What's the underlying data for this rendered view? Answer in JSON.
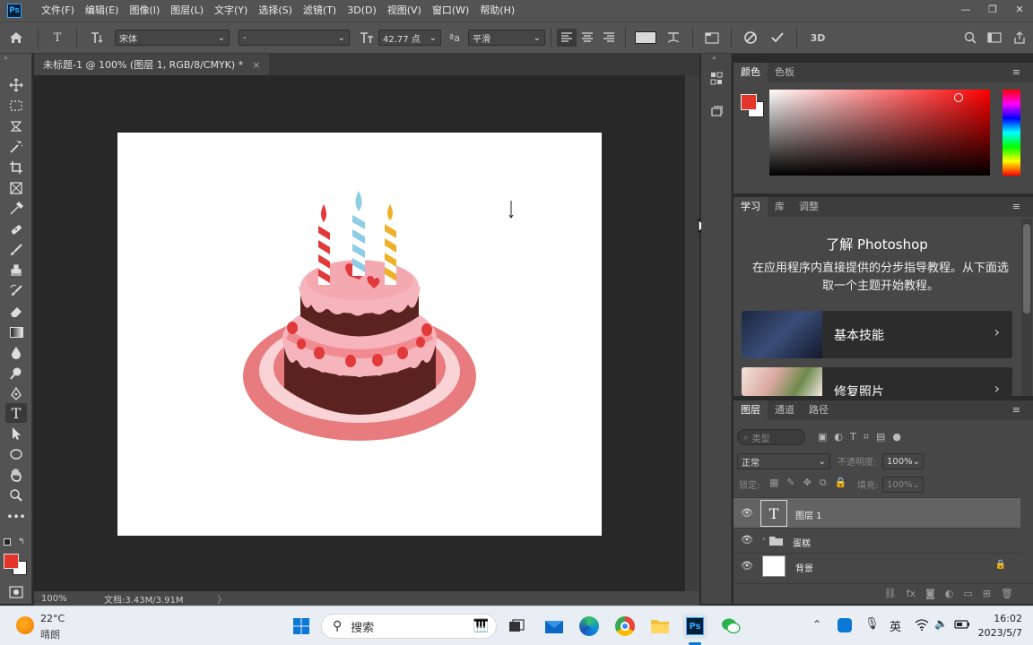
{
  "app": {
    "logo": "Ps"
  },
  "menu": [
    "文件(F)",
    "编辑(E)",
    "图像(I)",
    "图层(L)",
    "文字(Y)",
    "选择(S)",
    "滤镜(T)",
    "3D(D)",
    "视图(V)",
    "窗口(W)",
    "帮助(H)"
  ],
  "window_controls": {
    "minimize": "—",
    "restore": "❐",
    "close": "✕"
  },
  "options_bar": {
    "font_family": "宋体",
    "font_style": "-",
    "font_size": "42.77 点",
    "aa_label": "ªa",
    "antialias": "平滑",
    "mode_3d": "3D"
  },
  "document": {
    "tab_title": "未标题-1 @ 100% (图层 1, RGB/8/CMYK) *",
    "tab_close": "×"
  },
  "status": {
    "zoom": "100%",
    "doc_size": "文档:3.43M/3.91M",
    "arrow": "〉"
  },
  "color_panel": {
    "tabs": [
      "颜色",
      "色板"
    ],
    "foreground": "#e1352a",
    "background": "#ffffff"
  },
  "learn_panel": {
    "tabs": [
      "学习",
      "库",
      "调整"
    ],
    "title": "了解 Photoshop",
    "description": "在应用程序内直接提供的分步指导教程。从下面选取一个主题开始教程。",
    "cards": [
      {
        "label": "基本技能"
      },
      {
        "label": "修复照片"
      }
    ]
  },
  "layers_panel": {
    "tabs": [
      "图层",
      "通道",
      "路径"
    ],
    "filter_placeholder": "类型",
    "blend_mode": "正常",
    "opacity_label": "不透明度:",
    "opacity": "100%",
    "lock_label": "锁定:",
    "fill_label": "填充:",
    "fill": "100%",
    "layers": [
      {
        "name": "图层 1",
        "type": "text",
        "selected": true
      },
      {
        "name": "蛋糕",
        "type": "group",
        "selected": false
      },
      {
        "name": "背景",
        "type": "background",
        "selected": false,
        "locked": true
      }
    ]
  },
  "taskbar": {
    "weather_temp": "22°C",
    "weather_desc": "晴朗",
    "search_label": "搜索",
    "ime": "英",
    "time": "16:02",
    "date": "2023/5/7"
  },
  "colors": {
    "accent": "#31a8ff",
    "panel": "#474747",
    "ui": "#535353"
  }
}
